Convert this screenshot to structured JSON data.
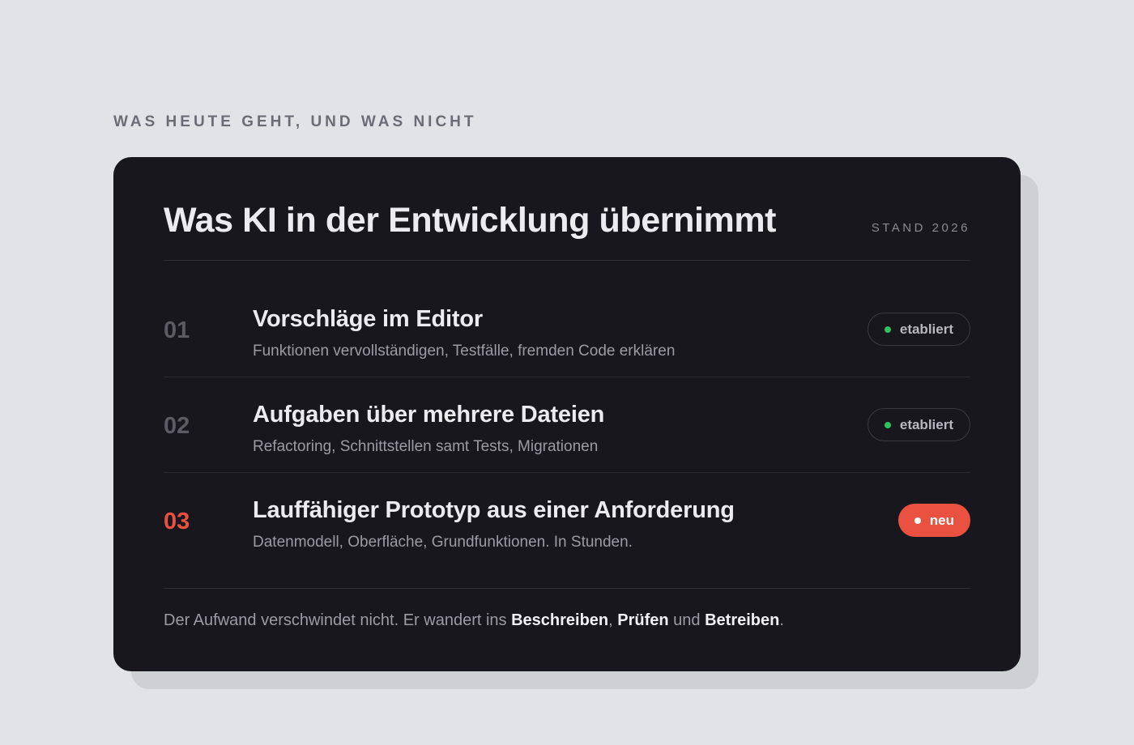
{
  "eyebrow": "WAS HEUTE GEHT, UND WAS NICHT",
  "card": {
    "title": "Was KI in der Entwicklung übernimmt",
    "stand": "STAND 2026",
    "rows": [
      {
        "number": "01",
        "title": "Vorschläge im Editor",
        "description": "Funktionen vervollständigen, Testfälle, fremden Code erklären",
        "badge": "etabliert",
        "badge_status_color": "#2fc25e"
      },
      {
        "number": "02",
        "title": "Aufgaben über mehrere Dateien",
        "description": "Refactoring, Schnittstellen samt Tests, Migrationen",
        "badge": "etabliert",
        "badge_status_color": "#2fc25e"
      },
      {
        "number": "03",
        "title": "Lauffähiger Prototyp aus einer Anforderung",
        "description": "Datenmodell, Oberfläche, Grundfunktionen. In Stunden.",
        "badge": "neu",
        "badge_status_color": "#ea5140"
      }
    ],
    "footer": {
      "intro": "Der Aufwand verschwindet nicht. Er wandert ins ",
      "term1": "Beschreiben",
      "sep1": ", ",
      "term2": "Prüfen",
      "sep2": " und ",
      "term3": "Betreiben",
      "end": "."
    }
  },
  "colors": {
    "background": "#e2e3e6",
    "card": "#18171d",
    "accent": "#ea5140",
    "established": "#2fc25e"
  }
}
